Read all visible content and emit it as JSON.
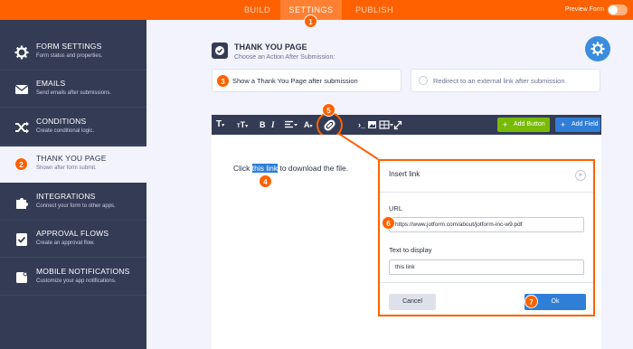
{
  "topbar": {
    "tabs": [
      "BUILD",
      "SETTINGS",
      "PUBLISH"
    ],
    "active_tab": "SETTINGS",
    "preview_label": "Preview Form"
  },
  "sidebar": {
    "items": [
      {
        "title": "FORM SETTINGS",
        "subtitle": "Form status and properties.",
        "icon": "gear-icon"
      },
      {
        "title": "EMAILS",
        "subtitle": "Send emails after submissions.",
        "icon": "envelope-icon"
      },
      {
        "title": "CONDITIONS",
        "subtitle": "Create conditional logic.",
        "icon": "shuffle-icon"
      },
      {
        "title": "THANK YOU PAGE",
        "subtitle": "Shown after form submit.",
        "icon": "step-badge",
        "active": true
      },
      {
        "title": "INTEGRATIONS",
        "subtitle": "Connect your form to other apps.",
        "icon": "puzzle-icon"
      },
      {
        "title": "APPROVAL FLOWS",
        "subtitle": "Create an approval flow.",
        "icon": "approval-icon"
      },
      {
        "title": "MOBILE NOTIFICATIONS",
        "subtitle": "Customize your app notifications.",
        "icon": "mobile-icon"
      }
    ]
  },
  "main": {
    "title": "THANK YOU PAGE",
    "subtitle": "Choose an Action After Submission:",
    "option_show": "Show a Thank You Page after submission",
    "option_redirect": "Redirect to an external link after submission"
  },
  "editor": {
    "toolbar": {
      "add_button": "Add Button",
      "add_field": "Add Field"
    },
    "text_before": "Click ",
    "text_selected": "this link",
    "text_after": " to download the file."
  },
  "dialog": {
    "title": "Insert link",
    "url_label": "URL",
    "url_value": "https://www.jotform.com/about/jotform-inc-w9.pdf",
    "text_label": "Text to display",
    "text_value": "this link",
    "cancel_label": "Cancel",
    "ok_label": "Ok"
  },
  "steps": [
    "1",
    "2",
    "3",
    "4",
    "5",
    "6",
    "7"
  ],
  "colors": {
    "accent": "#ff6100",
    "navy": "#343c55",
    "blue": "#2f7ed8",
    "green": "#78bb07",
    "background": "#f3f3fe"
  }
}
